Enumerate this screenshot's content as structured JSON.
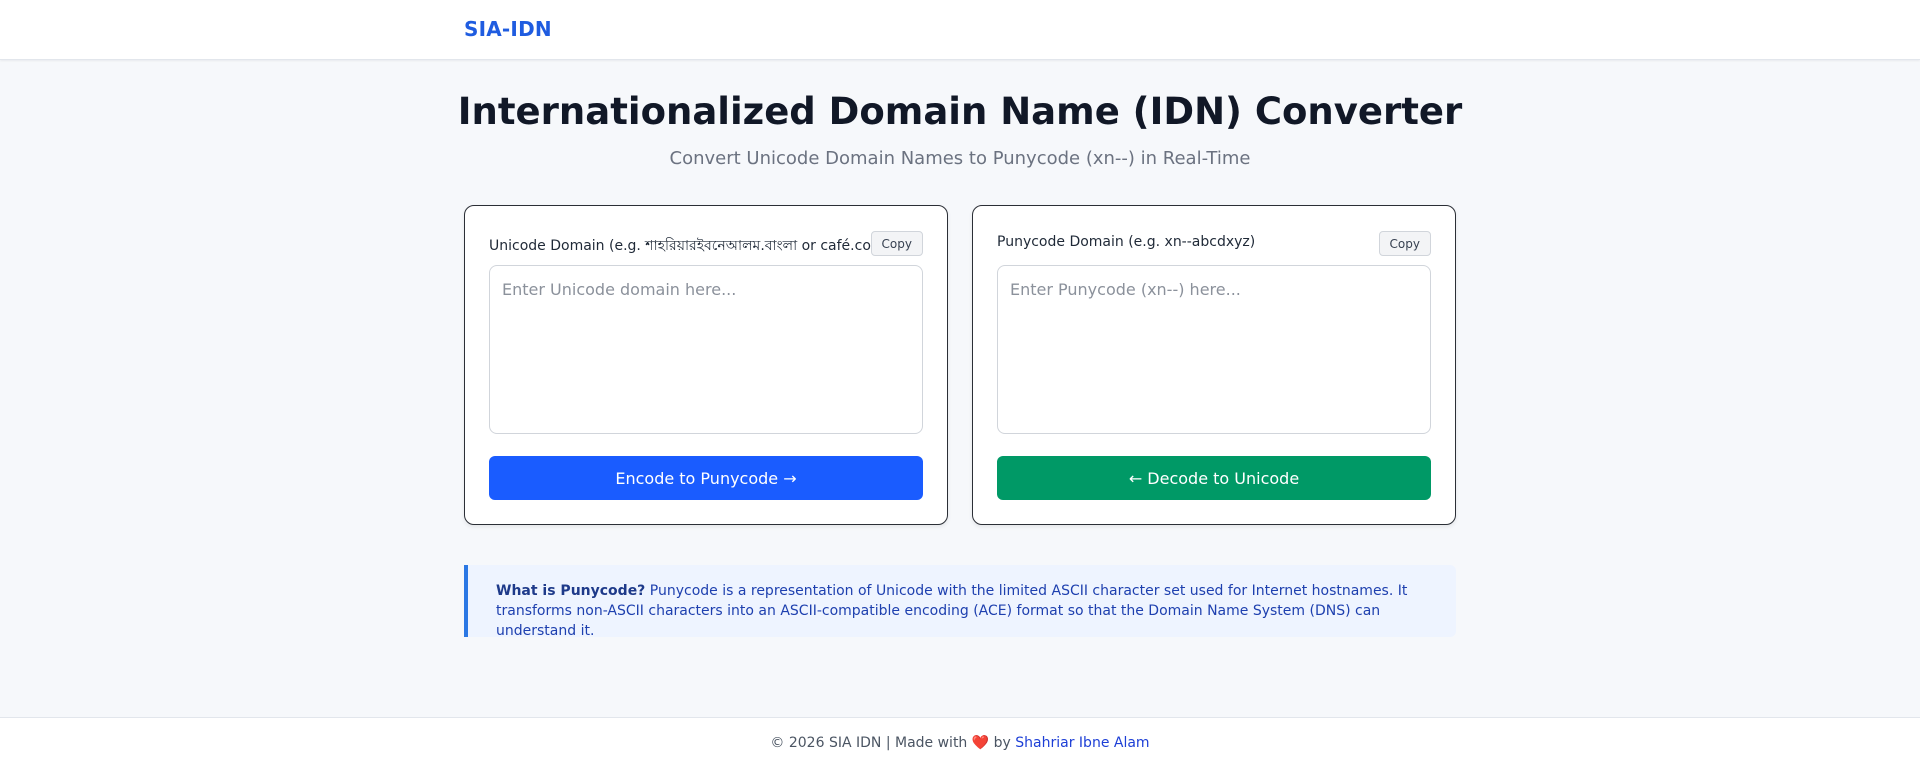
{
  "header": {
    "brand": "SIA-IDN"
  },
  "main": {
    "title": "Internationalized Domain Name (IDN) Converter",
    "subtitle": "Convert Unicode Domain Names to Punycode (xn--) in Real-Time"
  },
  "unicode_panel": {
    "label": "Unicode Domain (e.g. শাহরিয়ারইবনেআলম.বাংলা or café.com)",
    "copy_label": "Copy",
    "value": "",
    "placeholder": "Enter Unicode domain here...",
    "button_label": "Encode to Punycode →"
  },
  "punycode_panel": {
    "label": "Punycode Domain (e.g. xn--abcdxyz)",
    "copy_label": "Copy",
    "value": "",
    "placeholder": "Enter Punycode (xn--) here...",
    "button_label": "← Decode to Unicode"
  },
  "info": {
    "heading": "What is Punycode?",
    "text": "Punycode is a representation of Unicode with the limited ASCII character set used for Internet hostnames. It transforms non-ASCII characters into an ASCII-compatible encoding (ACE) format so that the Domain Name System (DNS) can understand it."
  },
  "footer": {
    "prefix": "© 2026 SIA IDN | Made with",
    "heart_icon": "heart-icon",
    "by": "by",
    "author_link": "Shahriar Ibne Alam"
  },
  "colors": {
    "brand": "#1f5ce0",
    "encode_button": "#1a5cff",
    "decode_button": "#009966",
    "info_border": "#2b78e4",
    "info_background": "#eef4ff",
    "heart": "#e11d2a"
  }
}
